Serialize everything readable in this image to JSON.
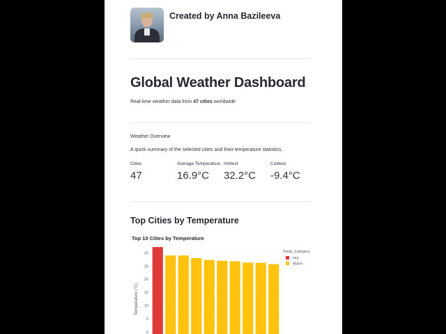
{
  "author": {
    "name": "Created by Anna Bazileeva"
  },
  "header": {
    "title": "Global Weather Dashboard",
    "subtitle_prefix": "Real-time weather data from ",
    "subtitle_bold": "47 cities",
    "subtitle_suffix": " worldwide"
  },
  "overview": {
    "label": "Weather Overview",
    "description": "A quick summary of the selected cities and their temperature statistics.",
    "metrics": [
      {
        "label": "Cities",
        "value": "47"
      },
      {
        "label": "Average Temperature",
        "value": "16.9°C"
      },
      {
        "label": "Hottest",
        "value": "32.2°C"
      },
      {
        "label": "Coldest",
        "value": "-9.4°C"
      }
    ]
  },
  "section_title": "Top Cities by Temperature",
  "chart_data": {
    "type": "bar",
    "title": "Top 10 Cities by Temperature",
    "ylabel": "Temperature (°C)",
    "ylim": [
      0,
      33
    ],
    "yticks": [
      0,
      5,
      10,
      15,
      20,
      25,
      30
    ],
    "legend": {
      "title": "Temp_Category",
      "position": "top-right",
      "entries": [
        {
          "name": "Hot",
          "color": "#e03a3a"
        },
        {
          "name": "Warm",
          "color": "#ffc20e"
        }
      ]
    },
    "values": [
      32.2,
      29.0,
      29.0,
      28.0,
      27.3,
      27.0,
      26.8,
      26.3,
      26.2,
      25.7
    ],
    "categories_of_bars": [
      "Hot",
      "Warm",
      "Warm",
      "Warm",
      "Warm",
      "Warm",
      "Warm",
      "Warm",
      "Warm",
      "Warm"
    ]
  }
}
